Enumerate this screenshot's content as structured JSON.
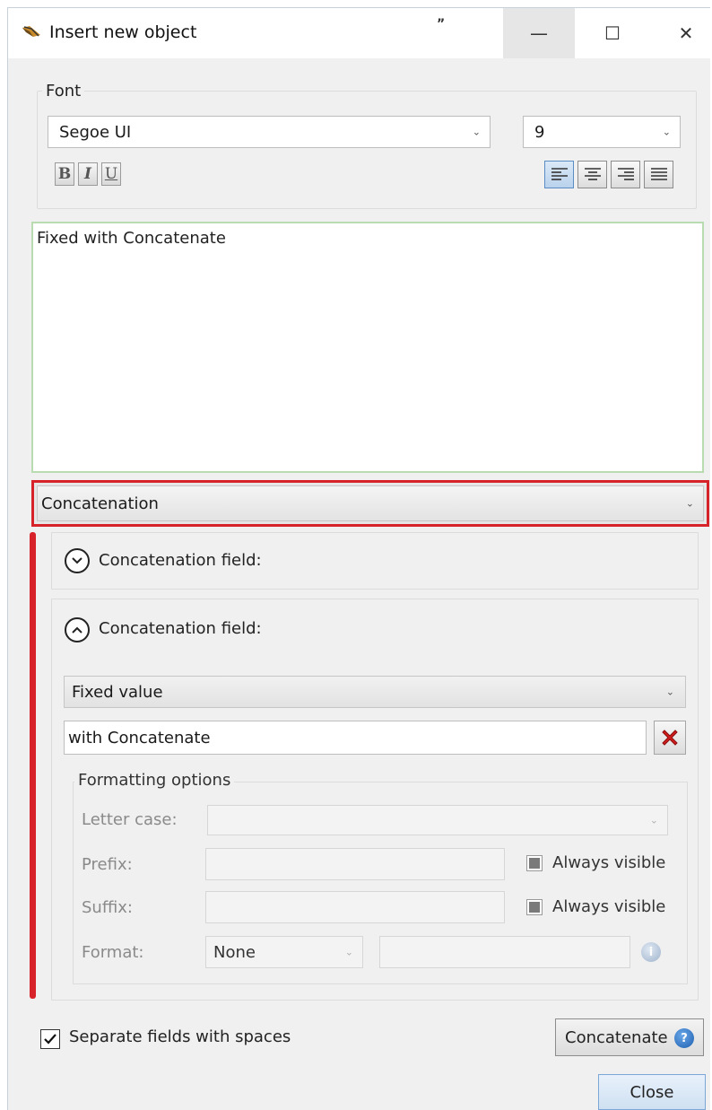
{
  "window": {
    "title": "Insert new object",
    "title_mark": "”",
    "controls": {
      "minimize": "—",
      "maximize": "☐",
      "close": "✕"
    }
  },
  "font": {
    "legend": "Font",
    "family": "Segoe UI",
    "size": "9",
    "bold": "B",
    "italic": "I",
    "underline": "U",
    "alignment_selected": "left"
  },
  "editor": {
    "text": "Fixed with Concatenate"
  },
  "object_type": {
    "selected": "Concatenation",
    "highlight_color": "#d8222a"
  },
  "fields": [
    {
      "label": "Concatenation field:",
      "expanded": false,
      "toggle_icon": "chevron-down-icon"
    },
    {
      "label": "Concatenation field:",
      "expanded": true,
      "toggle_icon": "chevron-up-icon",
      "type": "Fixed value",
      "value": "with Concatenate",
      "formatting": {
        "legend": "Formatting options",
        "letter_case_label": "Letter case:",
        "letter_case_value": "",
        "prefix_label": "Prefix:",
        "prefix_value": "",
        "prefix_always_visible": "Always visible",
        "suffix_label": "Suffix:",
        "suffix_value": "",
        "suffix_always_visible": "Always visible",
        "format_label": "Format:",
        "format_value": "None",
        "format_extra": ""
      }
    }
  ],
  "footer": {
    "separate_label": "Separate fields with spaces",
    "separate_checked": true,
    "concatenate_label": "Concatenate",
    "close_label": "Close"
  }
}
